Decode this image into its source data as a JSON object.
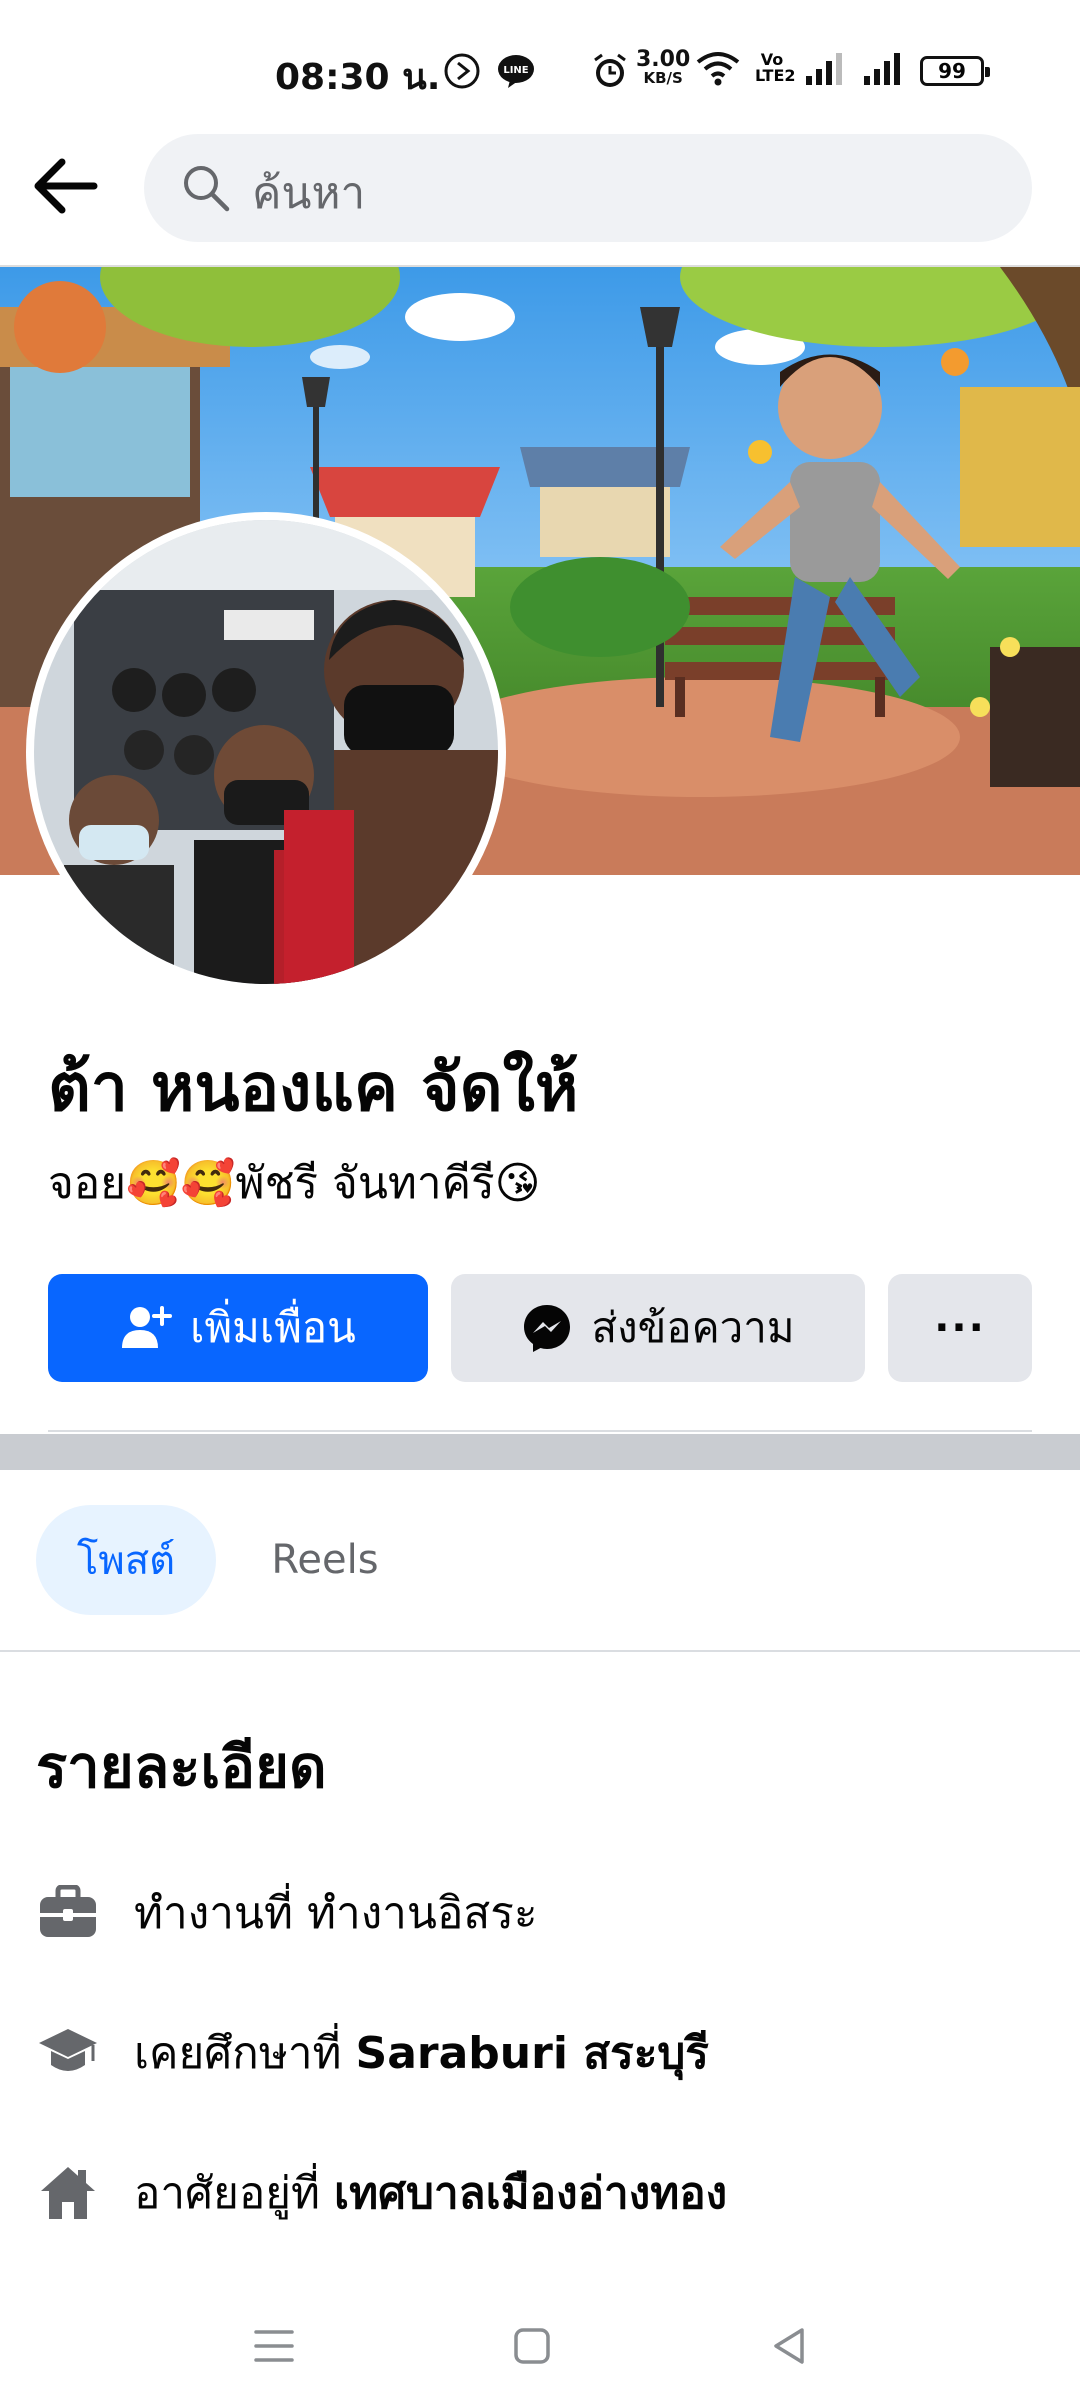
{
  "status_bar": {
    "time": "08:30 น.",
    "net_speed_value": "3.00",
    "net_speed_unit": "KB/S",
    "volte_label": "Vo LTE2",
    "battery": "99"
  },
  "search": {
    "placeholder": "ค้นหา"
  },
  "profile": {
    "name": "ต้า หนองแค จัดให้",
    "bio": "จอย🥰🥰พัชรี จันทาคีรี😘"
  },
  "actions": {
    "add_friend": "เพิ่มเพื่อน",
    "message": "ส่งข้อความ",
    "more": "···"
  },
  "tabs": [
    {
      "label": "โพสต์",
      "active": true
    },
    {
      "label": "Reels",
      "active": false
    }
  ],
  "details": {
    "title": "รายละเอียด",
    "work": {
      "prefix": "ทำงานที่ ",
      "value": "ทำงานอิสระ"
    },
    "education": {
      "prefix": "เคยศึกษาที่ ",
      "value": "Saraburi สระบุรี"
    },
    "home": {
      "prefix": "อาศัยอยู่ที่ ",
      "value": "เทศบาลเมืองอ่างทอง"
    }
  },
  "icons": {
    "back": "arrow-left-icon",
    "search": "search-icon",
    "add_friend": "add-person-icon",
    "message": "messenger-icon",
    "work": "briefcase-icon",
    "education": "graduation-cap-icon",
    "home": "house-icon"
  },
  "colors": {
    "primary": "#0866ff",
    "secondary_button": "#e4e6eb",
    "search_bg": "#f0f2f5",
    "tab_active_bg": "#e7f3ff",
    "muted_text": "#65676b"
  }
}
